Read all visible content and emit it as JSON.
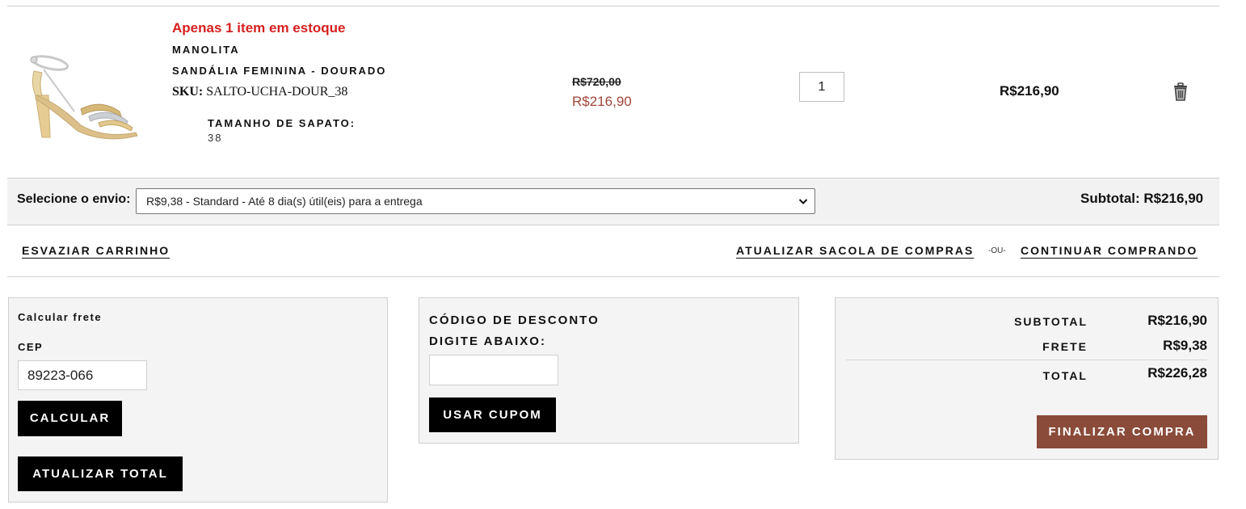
{
  "cart_item": {
    "stock_warning": "Apenas 1 item em estoque",
    "brand": "MANOLITA",
    "name": "SANDÁLIA FEMININA - DOURADO",
    "sku_label": "SKU:",
    "sku_value": "SALTO-UCHA-DOUR_38",
    "size_label": "TAMANHO DE SAPATO:",
    "size_value": "38",
    "original_price": "R$720,00",
    "price": "R$216,90",
    "quantity": "1",
    "row_total": "R$216,90",
    "delete_icon": "trash-icon",
    "image_icon": "sandal-image"
  },
  "shipping": {
    "label": "Selecione o envio:",
    "selected_option": "R$9,38 - Standard - Até 8 dia(s) útil(eis) para a entrega",
    "subtotal": "Subtotal: R$216,90"
  },
  "actions": {
    "empty_cart": "ESVAZIAR CARRINHO",
    "update_bag": "ATUALIZAR SACOLA DE COMPRAS",
    "or": "-OU-",
    "continue_shopping": "CONTINUAR COMPRANDO"
  },
  "freight_calc": {
    "title": "Calcular frete",
    "cep_label": "CEP",
    "cep_value": "89223-066",
    "calculate_button": "CALCULAR",
    "update_total_button": "ATUALIZAR TOTAL"
  },
  "discount": {
    "title": "CÓDIGO DE DESCONTO",
    "subtitle": "DIGITE ABAIXO:",
    "code_value": "",
    "apply_button": "USAR CUPOM"
  },
  "totals": {
    "subtotal_label": "SUBTOTAL",
    "subtotal_value": "R$216,90",
    "freight_label": "FRETE",
    "freight_value": "R$9,38",
    "total_label": "TOTAL",
    "total_value": "R$226,28",
    "checkout_button": "FINALIZAR COMPRA"
  },
  "colors": {
    "stock_warning": "#d62020",
    "sale_price": "#a0453a",
    "checkout_button": "#8a4b3a",
    "panel_bg": "#f4f4f4"
  }
}
